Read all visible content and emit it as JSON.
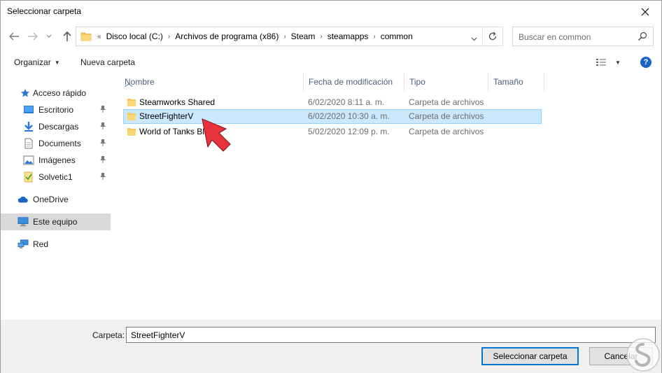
{
  "window": {
    "title": "Seleccionar carpeta"
  },
  "address": {
    "overflow": "«",
    "crumbs": [
      "Disco local (C:)",
      "Archivos de programa (x86)",
      "Steam",
      "steamapps",
      "common"
    ]
  },
  "search": {
    "placeholder": "Buscar en common"
  },
  "toolbar": {
    "organize": "Organizar",
    "new_folder": "Nueva carpeta",
    "help": "?"
  },
  "nav": {
    "quick_access": "Acceso rápido",
    "items": [
      "Escritorio",
      "Descargas",
      "Documents",
      "Imágenes",
      "Solvetic1"
    ],
    "onedrive": "OneDrive",
    "this_pc": "Este equipo",
    "network": "Red"
  },
  "columns": {
    "name": "Nombre",
    "date": "Fecha de modificación",
    "type": "Tipo",
    "size": "Tamaño"
  },
  "files": [
    {
      "name": "Steamworks Shared",
      "date": "6/02/2020 8:11 a. m.",
      "type": "Carpeta de archivos"
    },
    {
      "name": "StreetFighterV",
      "date": "6/02/2020 10:30 a. m.",
      "type": "Carpeta de archivos",
      "selected": true
    },
    {
      "name": "World of Tanks Blitz",
      "date": "5/02/2020 12:09 p. m.",
      "type": "Carpeta de archivos"
    }
  ],
  "footer": {
    "folder_label": "Carpeta:",
    "folder_value": "StreetFighterV",
    "select_button": "Seleccionar carpeta",
    "cancel_button": "Cancelar"
  },
  "colors": {
    "accent": "#0078d7",
    "selection": "#cce8ff",
    "folder": "#f5c95c",
    "arrow": "#e8333a"
  },
  "icons": {
    "close": "close-icon",
    "back": "back-arrow-icon",
    "forward": "forward-arrow-icon",
    "recent": "chevron-down-icon",
    "up": "up-arrow-icon",
    "refresh": "refresh-icon",
    "search": "search-icon",
    "folder": "folder-icon",
    "pin": "pin-icon"
  }
}
